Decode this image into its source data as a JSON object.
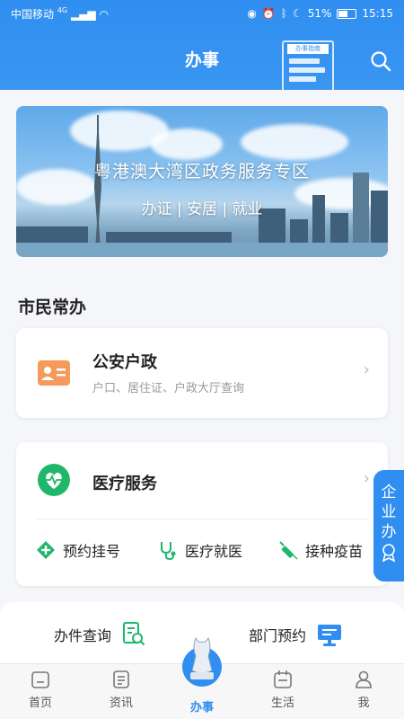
{
  "status_bar": {
    "carrier": "中国移动",
    "network": "4G",
    "battery": "51%",
    "time": "15:15"
  },
  "header": {
    "title": "办事",
    "guide_label": "办事指南",
    "search_icon": "search-icon"
  },
  "banner": {
    "title": "粤港澳大湾区政务服务专区",
    "subtitle": "办证 | 安居 | 就业"
  },
  "section": {
    "title": "市民常办"
  },
  "cards": [
    {
      "title": "公安户政",
      "subtitle": "户口、居住证、户政大厅查询",
      "icon": "id-card-icon",
      "color": "#f59a5b"
    },
    {
      "title": "医疗服务",
      "icon": "heart-monitor-icon",
      "color": "#1fb86a",
      "items": [
        {
          "label": "预约挂号",
          "icon": "appointment-icon"
        },
        {
          "label": "医疗就医",
          "icon": "stethoscope-icon"
        },
        {
          "label": "接种疫苗",
          "icon": "syringe-icon"
        }
      ]
    }
  ],
  "side_tab": {
    "label_chars": [
      "企",
      "业",
      "办"
    ]
  },
  "quick_actions": [
    {
      "label": "办件查询",
      "icon": "document-search-icon"
    },
    {
      "label": "部门预约",
      "icon": "monitor-icon"
    }
  ],
  "bottom_nav": [
    {
      "label": "首页",
      "icon": "home-icon",
      "active": false
    },
    {
      "label": "资讯",
      "icon": "news-icon",
      "active": false
    },
    {
      "label": "办事",
      "icon": "emblem-icon",
      "active": true
    },
    {
      "label": "生活",
      "icon": "calendar-icon",
      "active": false
    },
    {
      "label": "我",
      "icon": "user-icon",
      "active": false
    }
  ],
  "colors": {
    "primary": "#2f8ef0",
    "green": "#1fb86a",
    "orange": "#f59a5b"
  }
}
